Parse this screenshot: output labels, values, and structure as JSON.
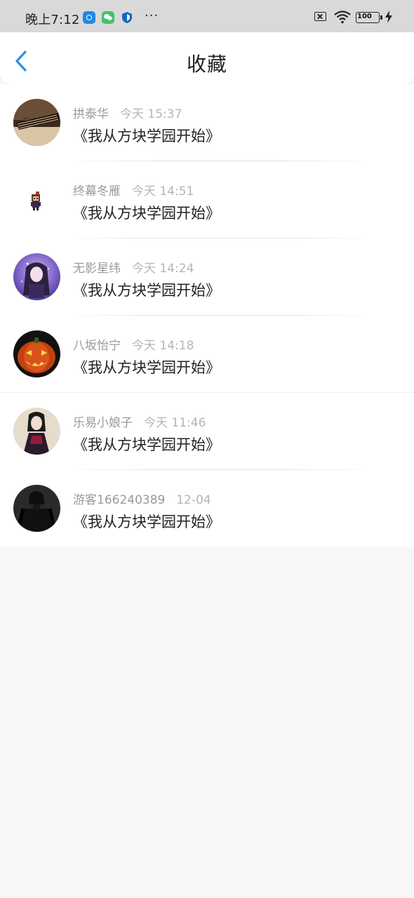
{
  "status_bar": {
    "time": "晚上7:12",
    "more": "···",
    "battery": "100",
    "apps": [
      "browser-app-icon",
      "wechat-icon",
      "shield-app-icon"
    ]
  },
  "header": {
    "title": "收藏",
    "back_icon": "chevron-left-icon",
    "accent_color": "#2d8fe0"
  },
  "favorites": [
    {
      "name": "拱泰华",
      "time": "今天 15:37",
      "content": "《我从方块学园开始》",
      "avatar": "guqin-photo"
    },
    {
      "name": "终幕冬雁",
      "time": "今天 14:51",
      "content": "《我从方块学园开始》",
      "avatar": "pixel-character"
    },
    {
      "name": "无影星纬",
      "time": "今天 14:24",
      "content": "《我从方块学园开始》",
      "avatar": "anime-girl-purple"
    },
    {
      "name": "八坂怡宁",
      "time": "今天 14:18",
      "content": "《我从方块学园开始》",
      "avatar": "jack-o-lantern"
    },
    {
      "name": "乐易小娘子",
      "time": "今天 11:46",
      "content": "《我从方块学园开始》",
      "avatar": "girl-portrait"
    },
    {
      "name": "游客166240389",
      "time": "12-04",
      "content": "《我从方块学园开始》",
      "avatar": "dark-figure"
    }
  ]
}
